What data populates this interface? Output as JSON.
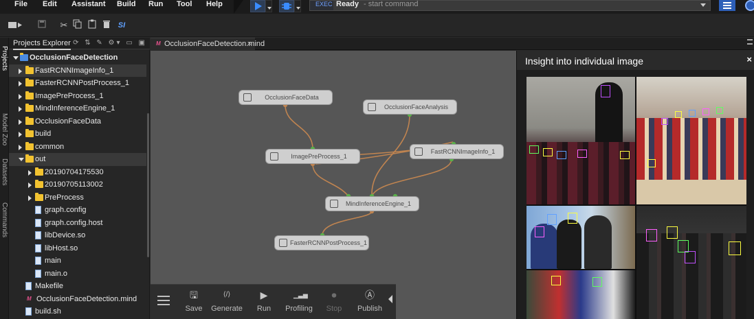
{
  "menubar": {
    "items": [
      "File",
      "Edit",
      "Assistant",
      "Build",
      "Run",
      "Tool",
      "Help"
    ]
  },
  "command_bar": {
    "mode": "EXEC",
    "status": "Ready",
    "hint": "- start command"
  },
  "toolbar": {
    "tools": [
      "deploy-icon",
      "save-icon",
      "cut-icon",
      "copy-icon",
      "paste-icon",
      "delete-icon",
      "si-icon"
    ],
    "si_label": "SI"
  },
  "side_tabs": [
    "Projects",
    "Model Zoo",
    "Datasets",
    "Commands"
  ],
  "explorer": {
    "title": "Projects Explorer",
    "tree": [
      {
        "label": "OcclusionFaceDetection",
        "type": "project",
        "depth": 0,
        "expanded": true
      },
      {
        "label": "FastRCNNImageInfo_1",
        "type": "folder",
        "depth": 1,
        "expanded": false,
        "selected": true
      },
      {
        "label": "FasterRCNNPostProcess_1",
        "type": "folder",
        "depth": 1,
        "expanded": false
      },
      {
        "label": "ImagePreProcess_1",
        "type": "folder",
        "depth": 1,
        "expanded": false
      },
      {
        "label": "MindInferenceEngine_1",
        "type": "folder",
        "depth": 1,
        "expanded": false
      },
      {
        "label": "OcclusionFaceData",
        "type": "folder",
        "depth": 1,
        "expanded": false
      },
      {
        "label": "build",
        "type": "folder",
        "depth": 1,
        "expanded": false
      },
      {
        "label": "common",
        "type": "folder",
        "depth": 1,
        "expanded": false
      },
      {
        "label": "out",
        "type": "folder",
        "depth": 1,
        "expanded": true,
        "selected": true
      },
      {
        "label": "20190704175530",
        "type": "folder",
        "depth": 2,
        "expanded": false
      },
      {
        "label": "20190705113002",
        "type": "folder",
        "depth": 2,
        "expanded": false
      },
      {
        "label": "PreProcess",
        "type": "folder",
        "depth": 2,
        "expanded": false
      },
      {
        "label": "graph.config",
        "type": "file",
        "depth": 2
      },
      {
        "label": "graph.config.host",
        "type": "file",
        "depth": 2
      },
      {
        "label": "libDevice.so",
        "type": "file",
        "depth": 2
      },
      {
        "label": "libHost.so",
        "type": "file",
        "depth": 2
      },
      {
        "label": "main",
        "type": "file",
        "depth": 2
      },
      {
        "label": "main.o",
        "type": "file",
        "depth": 2
      },
      {
        "label": "Makefile",
        "type": "file",
        "depth": 1
      },
      {
        "label": "OcclusionFaceDetection.mind",
        "type": "mind",
        "depth": 1
      },
      {
        "label": "build.sh",
        "type": "file",
        "depth": 1
      }
    ]
  },
  "editor": {
    "tab_label": "OcclusionFaceDetection.mind",
    "close": "×"
  },
  "graph": {
    "nodes": [
      {
        "id": "data",
        "label": "OcclusionFaceData",
        "icon": "cube-icon"
      },
      {
        "id": "analysis",
        "label": "OcclusionFaceAnalysis",
        "icon": "robot-icon"
      },
      {
        "id": "pre",
        "label": "ImagePreProcess_1",
        "icon": "gear-icon"
      },
      {
        "id": "info",
        "label": "FastRCNNImageInfo_1",
        "icon": "image-icon"
      },
      {
        "id": "mind",
        "label": "MindInferenceEngine_1",
        "icon": "engine-icon"
      },
      {
        "id": "post",
        "label": "FasterRCNNPostProcess_1",
        "icon": "car-icon"
      }
    ],
    "edges": [
      [
        "data",
        "pre"
      ],
      [
        "pre",
        "info"
      ],
      [
        "info",
        "pre"
      ],
      [
        "pre",
        "mind"
      ],
      [
        "info",
        "mind"
      ],
      [
        "analysis",
        "mind"
      ],
      [
        "mind",
        "post"
      ]
    ]
  },
  "palette": {
    "buttons": [
      {
        "label": "Save",
        "icon": "save-icon",
        "enabled": true
      },
      {
        "label": "Generate",
        "icon": "code-icon",
        "enabled": true
      },
      {
        "label": "Run",
        "icon": "play-icon",
        "enabled": true
      },
      {
        "label": "Profiling",
        "icon": "bars-icon",
        "enabled": true
      },
      {
        "label": "Stop",
        "icon": "stop-icon",
        "enabled": false
      },
      {
        "label": "Publish",
        "icon": "publish-icon",
        "enabled": true
      }
    ]
  },
  "insight": {
    "title": "Insight into individual image",
    "close": "×"
  },
  "colors": {
    "accent": "#2d5fb8",
    "folder": "#f2c230",
    "edge": "#c08450",
    "port": "#5ab04a"
  }
}
